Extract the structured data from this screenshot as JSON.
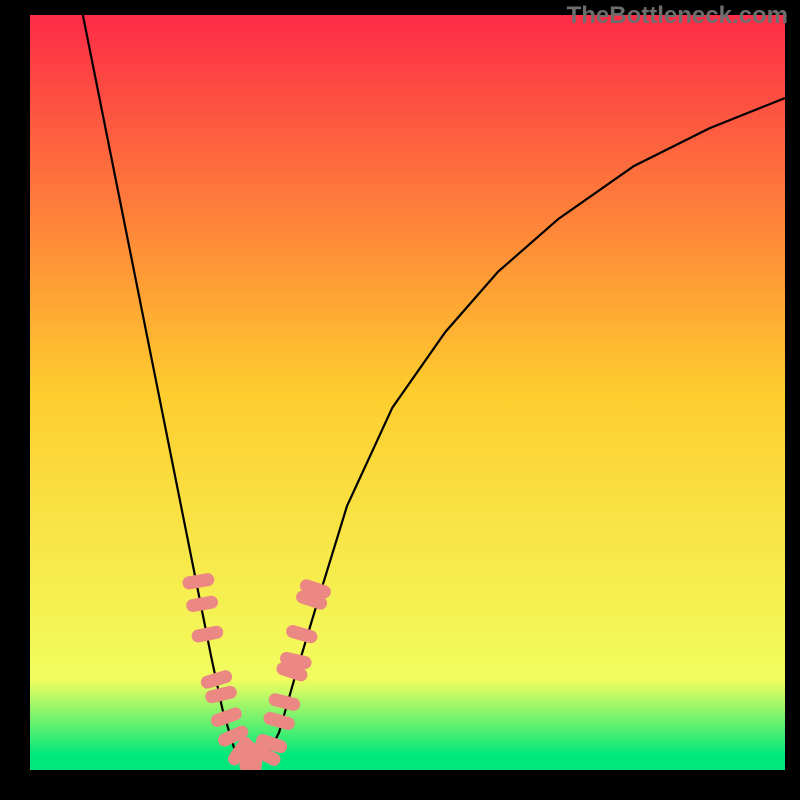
{
  "watermark": "TheBottleneck.com",
  "chart_data": {
    "type": "line",
    "title": "",
    "xlabel": "",
    "ylabel": "",
    "xlim": [
      0,
      100
    ],
    "ylim": [
      0,
      100
    ],
    "background_gradient": {
      "stops": [
        {
          "offset": 0,
          "color": "#fd2b47"
        },
        {
          "offset": 50,
          "color": "#fecd2e"
        },
        {
          "offset": 88,
          "color": "#f2fd5f"
        },
        {
          "offset": 98,
          "color": "#00e87b"
        }
      ]
    },
    "series": [
      {
        "name": "left-curve",
        "type": "line",
        "color": "#000000",
        "points": [
          {
            "x": 7,
            "y": 100
          },
          {
            "x": 8,
            "y": 95
          },
          {
            "x": 10,
            "y": 85
          },
          {
            "x": 12,
            "y": 75
          },
          {
            "x": 14,
            "y": 65
          },
          {
            "x": 16,
            "y": 55
          },
          {
            "x": 18,
            "y": 45
          },
          {
            "x": 20,
            "y": 35
          },
          {
            "x": 22,
            "y": 25
          },
          {
            "x": 24,
            "y": 15
          },
          {
            "x": 25.5,
            "y": 8
          },
          {
            "x": 27,
            "y": 3
          },
          {
            "x": 28.5,
            "y": 1.5
          },
          {
            "x": 30,
            "y": 1.5
          }
        ]
      },
      {
        "name": "right-curve",
        "type": "line",
        "color": "#000000",
        "points": [
          {
            "x": 30,
            "y": 1.5
          },
          {
            "x": 31.5,
            "y": 2
          },
          {
            "x": 33,
            "y": 5
          },
          {
            "x": 35,
            "y": 12
          },
          {
            "x": 38,
            "y": 22
          },
          {
            "x": 42,
            "y": 35
          },
          {
            "x": 48,
            "y": 48
          },
          {
            "x": 55,
            "y": 58
          },
          {
            "x": 62,
            "y": 66
          },
          {
            "x": 70,
            "y": 73
          },
          {
            "x": 80,
            "y": 80
          },
          {
            "x": 90,
            "y": 85
          },
          {
            "x": 100,
            "y": 89
          }
        ]
      },
      {
        "name": "left-markers",
        "type": "scatter",
        "color": "#eb8883",
        "marker_shape": "rounded-rect",
        "points": [
          {
            "x": 22.3,
            "y": 25
          },
          {
            "x": 22.8,
            "y": 22
          },
          {
            "x": 23.5,
            "y": 18
          },
          {
            "x": 24.7,
            "y": 12
          },
          {
            "x": 25.3,
            "y": 10
          },
          {
            "x": 26,
            "y": 7
          },
          {
            "x": 26.9,
            "y": 4.5
          },
          {
            "x": 27.8,
            "y": 2.5
          },
          {
            "x": 28.8,
            "y": 1.8
          },
          {
            "x": 30,
            "y": 1.6
          }
        ]
      },
      {
        "name": "right-markers",
        "type": "scatter",
        "color": "#eb8883",
        "marker_shape": "rounded-rect",
        "points": [
          {
            "x": 31.2,
            "y": 2
          },
          {
            "x": 32,
            "y": 3.5
          },
          {
            "x": 33,
            "y": 6.5
          },
          {
            "x": 33.7,
            "y": 9
          },
          {
            "x": 34.7,
            "y": 13
          },
          {
            "x": 35.2,
            "y": 14.5
          },
          {
            "x": 36,
            "y": 18
          },
          {
            "x": 37.3,
            "y": 22.5
          },
          {
            "x": 37.8,
            "y": 24
          }
        ]
      }
    ]
  }
}
